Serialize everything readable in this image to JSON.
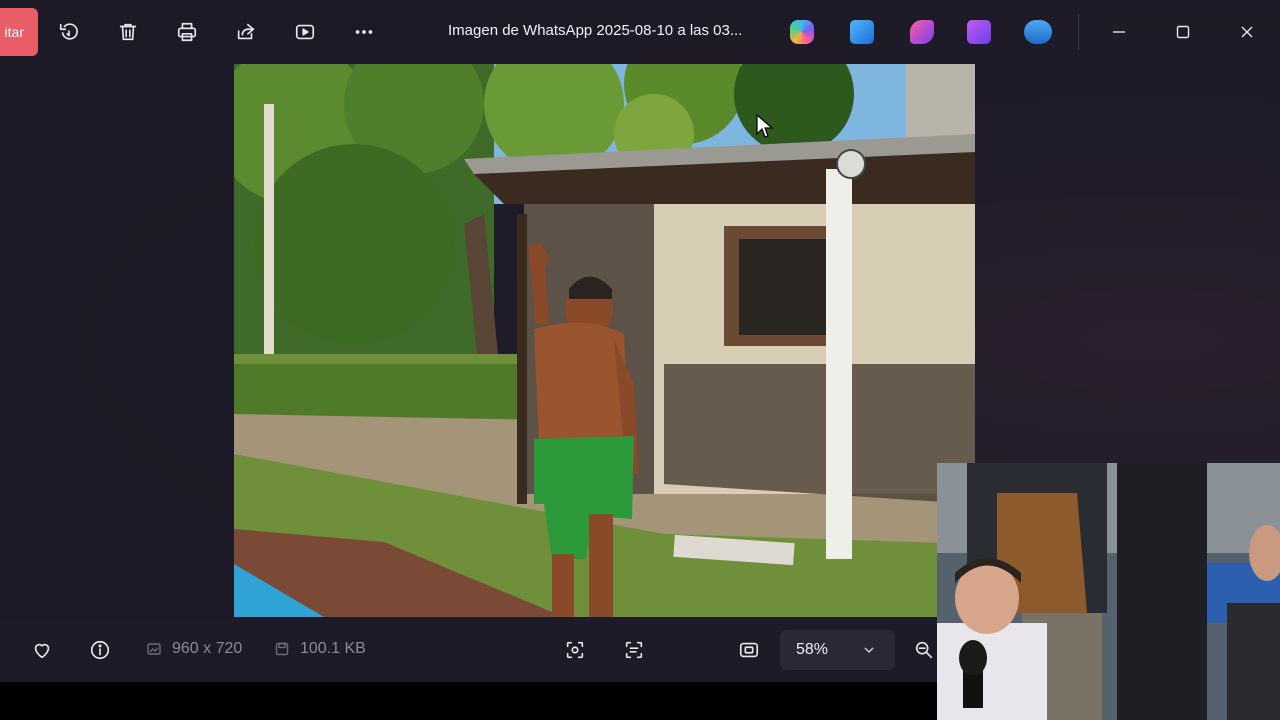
{
  "toolbar": {
    "edit_label": "itar",
    "title": "Imagen de WhatsApp 2025-08-10 a las 03...",
    "icons": [
      "rotate-icon",
      "delete-icon",
      "print-icon",
      "share-icon",
      "slideshow-icon",
      "more-icon"
    ],
    "app_icons": [
      "copilot-icon",
      "photo-editor-icon",
      "clipchamp-icon",
      "designer-icon",
      "onedrive-icon"
    ]
  },
  "window_controls": [
    "minimize-icon",
    "maximize-icon",
    "close-icon"
  ],
  "bottom_bar": {
    "dimensions": "960 x 720",
    "file_size": "100.1 KB",
    "zoom": "58%",
    "icons": [
      "favorite-icon",
      "info-icon",
      "visual-search-icon",
      "text-extract-icon",
      "fit-to-window-icon",
      "zoom-out-icon"
    ]
  },
  "colors": {
    "accent_edit": "#e85d68",
    "background": "#1f1b28",
    "bottom_bar": "#1d1b27"
  }
}
